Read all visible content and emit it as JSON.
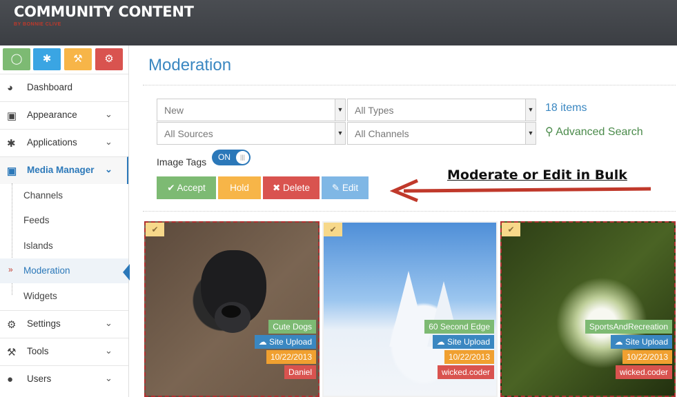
{
  "app": {
    "title": "COMMUNITY CONTENT",
    "subtitle": "BY BONNIE CLIVE"
  },
  "quick_buttons": [
    {
      "icon": "camera-icon",
      "color": "#7dba73"
    },
    {
      "icon": "asterisk-icon",
      "color": "#3aa5e3"
    },
    {
      "icon": "wrench-icon",
      "color": "#f7b548"
    },
    {
      "icon": "gears-icon",
      "color": "#d9534f"
    }
  ],
  "sidebar": {
    "items": [
      {
        "label": "Dashboard",
        "icon": "dashboard-icon"
      },
      {
        "label": "Appearance",
        "icon": "picture-icon"
      },
      {
        "label": "Applications",
        "icon": "asterisk-icon"
      },
      {
        "label": "Media Manager",
        "icon": "camera-icon"
      },
      {
        "label": "Settings",
        "icon": "gears-icon"
      },
      {
        "label": "Tools",
        "icon": "wrench-icon"
      },
      {
        "label": "Users",
        "icon": "user-icon"
      }
    ],
    "subitems": [
      "Channels",
      "Feeds",
      "Islands",
      "Moderation",
      "Widgets"
    ]
  },
  "page": {
    "title": "Moderation"
  },
  "filters": {
    "status": "New",
    "types": "All Types",
    "sources": "All Sources",
    "channels": "All Channels",
    "count": "18 items",
    "advanced": "Advanced Search"
  },
  "image_tags": {
    "label": "Image Tags",
    "state": "ON"
  },
  "actions": {
    "accept": "Accept",
    "hold": "Hold",
    "delete": "Delete",
    "edit": "Edit"
  },
  "annotation": "Moderate or Edit in Bulk",
  "colors": {
    "accent": "#2b78b9",
    "accept": "#7dba73",
    "hold": "#f7b548",
    "delete": "#d9534f",
    "edit": "#7fb7e5",
    "annotation_arrow": "#c0392b"
  },
  "cards": [
    {
      "channel": "Cute Dogs",
      "source": "Site Upload",
      "date": "10/22/2013",
      "user": "Daniel",
      "selected": true
    },
    {
      "channel": "60 Second Edge",
      "source": "Site Upload",
      "date": "10/22/2013",
      "user": "wicked.coder",
      "selected": false
    },
    {
      "channel": "SportsAndRecreation",
      "source": "Site Upload",
      "date": "10/22/2013",
      "user": "wicked.coder",
      "selected": true
    }
  ]
}
